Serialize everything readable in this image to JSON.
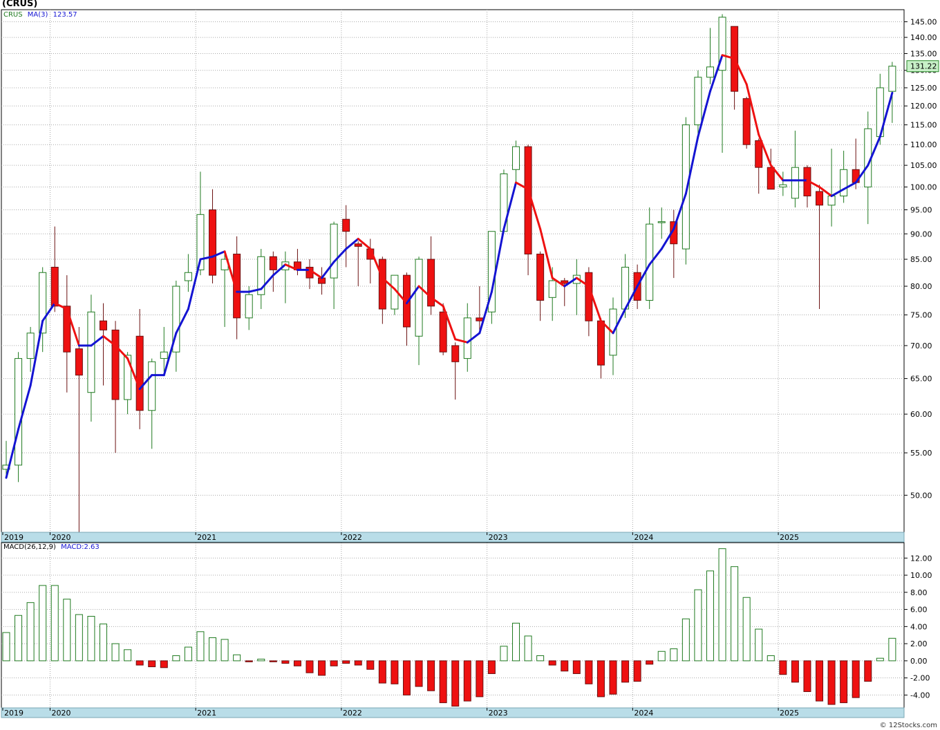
{
  "header": {
    "title": "(CRUS)",
    "symbol_label": "CRUS",
    "ma_label": "MA(3)",
    "ma_value": "123.57",
    "macd_label": "MACD(26,12,9)",
    "macd_value_label": "MACD:2.63",
    "last_price_label": "131.22",
    "footer_credit": "© 12Stocks.com"
  },
  "colors": {
    "up_fill": "#ffffff",
    "up_stroke": "#1f7a1f",
    "down_fill": "#ee1111",
    "down_stroke": "#6b1010",
    "ma_up": "#1414d2",
    "ma_down": "#ee1111",
    "grid": "#a8a8a8",
    "axis_strip": "#b9dde8",
    "price_badge_bg": "#c8f0c8"
  },
  "chart_data": [
    {
      "type": "candlestick",
      "name": "price",
      "interval": "monthly",
      "scale": "log",
      "ylim": [
        46,
        149
      ],
      "yticks": [
        50,
        55,
        60,
        65,
        70,
        75,
        80,
        85,
        90,
        95,
        100,
        105,
        110,
        115,
        120,
        125,
        130,
        135,
        140,
        145
      ],
      "x_year_labels": [
        {
          "label": "2019",
          "index": 0
        },
        {
          "label": "2020",
          "index": 4
        },
        {
          "label": "2021",
          "index": 16
        },
        {
          "label": "2022",
          "index": 28
        },
        {
          "label": "2023",
          "index": 40
        },
        {
          "label": "2024",
          "index": 52
        },
        {
          "label": "2025",
          "index": 64
        }
      ],
      "grid": true,
      "candles": [
        {
          "o": 53.0,
          "h": 56.5,
          "l": 52.0,
          "c": 53.5
        },
        {
          "o": 53.5,
          "h": 69.0,
          "l": 51.5,
          "c": 68.0
        },
        {
          "o": 68.0,
          "h": 73.0,
          "l": 66.0,
          "c": 72.0
        },
        {
          "o": 72.0,
          "h": 83.5,
          "l": 69.0,
          "c": 82.5
        },
        {
          "o": 83.5,
          "h": 91.5,
          "l": 75.5,
          "c": 76.5
        },
        {
          "o": 76.5,
          "h": 82.0,
          "l": 63.0,
          "c": 69.0
        },
        {
          "o": 69.5,
          "h": 73.0,
          "l": 46.0,
          "c": 65.5
        },
        {
          "o": 63.0,
          "h": 78.5,
          "l": 59.0,
          "c": 75.5
        },
        {
          "o": 74.0,
          "h": 77.0,
          "l": 64.0,
          "c": 72.5
        },
        {
          "o": 72.5,
          "h": 74.0,
          "l": 55.0,
          "c": 62.0
        },
        {
          "o": 62.0,
          "h": 69.0,
          "l": 60.0,
          "c": 68.5
        },
        {
          "o": 71.5,
          "h": 76.0,
          "l": 58.0,
          "c": 60.5
        },
        {
          "o": 60.5,
          "h": 68.0,
          "l": 55.5,
          "c": 67.5
        },
        {
          "o": 68.0,
          "h": 73.0,
          "l": 66.0,
          "c": 69.0
        },
        {
          "o": 69.0,
          "h": 81.0,
          "l": 66.0,
          "c": 80.0
        },
        {
          "o": 81.0,
          "h": 86.0,
          "l": 79.0,
          "c": 82.5
        },
        {
          "o": 83.0,
          "h": 103.5,
          "l": 82.0,
          "c": 94.0
        },
        {
          "o": 95.0,
          "h": 99.5,
          "l": 80.5,
          "c": 82.0
        },
        {
          "o": 83.0,
          "h": 86.0,
          "l": 73.0,
          "c": 85.0
        },
        {
          "o": 86.0,
          "h": 89.5,
          "l": 71.0,
          "c": 74.5
        },
        {
          "o": 74.5,
          "h": 80.0,
          "l": 72.5,
          "c": 78.5
        },
        {
          "o": 78.5,
          "h": 87.0,
          "l": 76.0,
          "c": 85.5
        },
        {
          "o": 85.5,
          "h": 86.5,
          "l": 79.0,
          "c": 83.0
        },
        {
          "o": 83.0,
          "h": 86.5,
          "l": 77.0,
          "c": 84.5
        },
        {
          "o": 84.5,
          "h": 87.0,
          "l": 82.0,
          "c": 83.0
        },
        {
          "o": 83.5,
          "h": 85.0,
          "l": 79.5,
          "c": 81.5
        },
        {
          "o": 81.5,
          "h": 83.5,
          "l": 78.5,
          "c": 80.5
        },
        {
          "o": 81.5,
          "h": 92.5,
          "l": 76.0,
          "c": 92.0
        },
        {
          "o": 93.0,
          "h": 96.0,
          "l": 83.5,
          "c": 90.5
        },
        {
          "o": 88.0,
          "h": 88.5,
          "l": 80.0,
          "c": 87.5
        },
        {
          "o": 87.0,
          "h": 89.0,
          "l": 80.5,
          "c": 85.0
        },
        {
          "o": 85.0,
          "h": 85.5,
          "l": 73.5,
          "c": 76.0
        },
        {
          "o": 76.0,
          "h": 82.0,
          "l": 75.0,
          "c": 82.0
        },
        {
          "o": 82.0,
          "h": 82.5,
          "l": 70.0,
          "c": 73.0
        },
        {
          "o": 71.5,
          "h": 85.5,
          "l": 67.0,
          "c": 85.0
        },
        {
          "o": 85.0,
          "h": 89.5,
          "l": 75.0,
          "c": 76.5
        },
        {
          "o": 75.5,
          "h": 77.0,
          "l": 68.5,
          "c": 69.0
        },
        {
          "o": 70.0,
          "h": 70.5,
          "l": 62.0,
          "c": 67.5
        },
        {
          "o": 68.0,
          "h": 77.0,
          "l": 66.0,
          "c": 74.5
        },
        {
          "o": 74.5,
          "h": 80.0,
          "l": 72.5,
          "c": 74.0
        },
        {
          "o": 75.5,
          "h": 90.5,
          "l": 73.5,
          "c": 90.5
        },
        {
          "o": 90.5,
          "h": 104.0,
          "l": 90.0,
          "c": 103.0
        },
        {
          "o": 104.0,
          "h": 111.0,
          "l": 100.5,
          "c": 109.5
        },
        {
          "o": 109.5,
          "h": 110.0,
          "l": 82.0,
          "c": 86.0
        },
        {
          "o": 86.0,
          "h": 86.5,
          "l": 74.0,
          "c": 77.5
        },
        {
          "o": 78.0,
          "h": 83.5,
          "l": 74.0,
          "c": 81.0
        },
        {
          "o": 81.0,
          "h": 81.5,
          "l": 76.5,
          "c": 80.5
        },
        {
          "o": 80.5,
          "h": 85.0,
          "l": 75.0,
          "c": 82.0
        },
        {
          "o": 82.5,
          "h": 83.5,
          "l": 71.5,
          "c": 74.0
        },
        {
          "o": 74.0,
          "h": 74.5,
          "l": 65.0,
          "c": 67.0
        },
        {
          "o": 68.5,
          "h": 78.0,
          "l": 65.5,
          "c": 76.0
        },
        {
          "o": 76.0,
          "h": 86.0,
          "l": 74.5,
          "c": 83.5
        },
        {
          "o": 82.5,
          "h": 84.0,
          "l": 76.0,
          "c": 77.5
        },
        {
          "o": 77.5,
          "h": 95.5,
          "l": 76.0,
          "c": 92.0
        },
        {
          "o": 92.5,
          "h": 95.5,
          "l": 89.0,
          "c": 92.5
        },
        {
          "o": 92.5,
          "h": 95.0,
          "l": 81.5,
          "c": 88.0
        },
        {
          "o": 87.0,
          "h": 117.0,
          "l": 84.0,
          "c": 115.0
        },
        {
          "o": 115.0,
          "h": 130.0,
          "l": 112.0,
          "c": 128.0
        },
        {
          "o": 128.0,
          "h": 143.0,
          "l": 126.0,
          "c": 131.0
        },
        {
          "o": 130.0,
          "h": 147.5,
          "l": 108.0,
          "c": 146.5
        },
        {
          "o": 143.5,
          "h": 143.5,
          "l": 119.0,
          "c": 124.0
        },
        {
          "o": 122.0,
          "h": 122.5,
          "l": 109.0,
          "c": 110.0
        },
        {
          "o": 111.0,
          "h": 111.5,
          "l": 98.5,
          "c": 104.5
        },
        {
          "o": 104.5,
          "h": 109.0,
          "l": 99.5,
          "c": 99.5
        },
        {
          "o": 100.0,
          "h": 103.5,
          "l": 98.0,
          "c": 100.5
        },
        {
          "o": 97.5,
          "h": 113.5,
          "l": 95.5,
          "c": 104.5
        },
        {
          "o": 104.5,
          "h": 105.0,
          "l": 95.5,
          "c": 98.0
        },
        {
          "o": 99.0,
          "h": 100.5,
          "l": 76.0,
          "c": 96.0
        },
        {
          "o": 96.0,
          "h": 109.0,
          "l": 91.5,
          "c": 98.0
        },
        {
          "o": 98.0,
          "h": 108.5,
          "l": 96.5,
          "c": 104.0
        },
        {
          "o": 104.0,
          "h": 111.5,
          "l": 99.5,
          "c": 101.0
        },
        {
          "o": 100.0,
          "h": 118.5,
          "l": 92.0,
          "c": 114.0
        },
        {
          "o": 112.0,
          "h": 129.0,
          "l": 110.0,
          "c": 125.0
        },
        {
          "o": 124.0,
          "h": 132.5,
          "l": 115.5,
          "c": 131.22
        }
      ],
      "ma3": {
        "name": "MA(3)",
        "values": [
          52.0,
          58.0,
          64.0,
          74.0,
          77.0,
          76.0,
          70.0,
          70.0,
          71.5,
          70.0,
          68.0,
          63.5,
          65.5,
          65.5,
          72.0,
          76.0,
          85.0,
          85.5,
          86.5,
          79.0,
          79.0,
          79.5,
          82.0,
          84.0,
          83.0,
          83.0,
          81.5,
          84.5,
          87.0,
          89.0,
          87.0,
          81.5,
          79.5,
          77.0,
          80.0,
          78.0,
          76.5,
          71.0,
          70.5,
          72.0,
          79.0,
          91.0,
          101.0,
          99.5,
          91.0,
          81.5,
          80.0,
          81.5,
          80.0,
          74.0,
          72.0,
          76.0,
          80.0,
          84.0,
          87.0,
          91.0,
          98.5,
          112.0,
          124.0,
          134.5,
          133.5,
          126.0,
          112.5,
          105.0,
          101.5,
          101.5,
          101.5,
          100.0,
          98.0,
          99.5,
          101.0,
          105.0,
          112.0,
          123.57
        ]
      }
    },
    {
      "type": "bar",
      "name": "MACD histogram",
      "ylim": [
        -5.5,
        13.8
      ],
      "yticks": [
        -4.0,
        -2.0,
        0.0,
        2.0,
        4.0,
        6.0,
        8.0,
        10.0,
        12.0
      ],
      "values": [
        3.3,
        5.3,
        6.8,
        8.8,
        8.8,
        7.2,
        5.4,
        5.2,
        4.3,
        2.0,
        1.3,
        -0.5,
        -0.7,
        -0.8,
        0.6,
        1.6,
        3.4,
        2.7,
        2.5,
        0.7,
        -0.1,
        0.2,
        -0.1,
        -0.3,
        -0.6,
        -1.4,
        -1.7,
        -0.6,
        -0.3,
        -0.5,
        -1.0,
        -2.6,
        -2.7,
        -4.0,
        -3.0,
        -3.5,
        -4.9,
        -5.3,
        -4.7,
        -4.2,
        -1.5,
        1.7,
        4.4,
        2.9,
        0.6,
        -0.5,
        -1.2,
        -1.5,
        -2.7,
        -4.2,
        -3.9,
        -2.5,
        -2.4,
        -0.4,
        1.1,
        1.4,
        4.9,
        8.3,
        10.5,
        13.1,
        11.0,
        7.4,
        3.7,
        0.6,
        -1.6,
        -2.5,
        -3.6,
        -4.7,
        -5.1,
        -4.9,
        -4.3,
        -2.4,
        0.3,
        2.63
      ]
    }
  ]
}
